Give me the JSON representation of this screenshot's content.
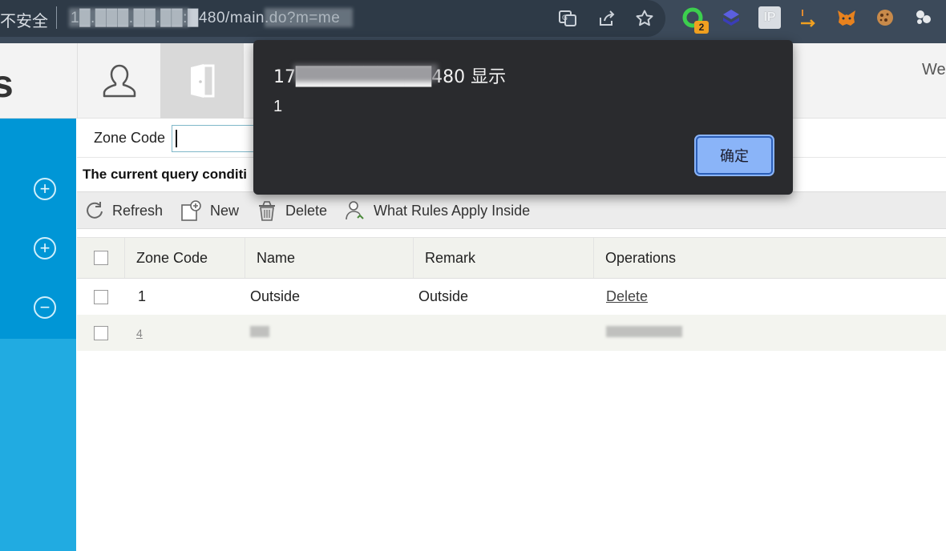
{
  "browser": {
    "security_label": "不安全",
    "url": "1█.███.██.██:█480/main.do?m=me",
    "extension_badge": "2",
    "ip_ext_label": "IP"
  },
  "header": {
    "brand_fragment": "s",
    "welcome": "We"
  },
  "query": {
    "zone_code_label": "Zone Code",
    "zone_code_value": "",
    "condition_text": "The current query conditi"
  },
  "toolbar": {
    "refresh": "Refresh",
    "new": "New",
    "delete": "Delete",
    "rules": "What Rules Apply Inside"
  },
  "table": {
    "headers": [
      "Zone Code",
      "Name",
      "Remark",
      "Operations"
    ],
    "rows": [
      {
        "zone_code": "1",
        "name": "Outside",
        "remark": "Outside",
        "operation": "Delete"
      },
      {
        "zone_code": "4",
        "name": "",
        "remark": "",
        "operation": ""
      }
    ]
  },
  "alert": {
    "title": "17██████████480 显示",
    "message": "1",
    "ok_label": "确定"
  },
  "colors": {
    "sidebar_dark": "#0096d6",
    "sidebar_light": "#21abe1",
    "dialog_bg": "#2a2b2e",
    "dialog_button": "#8ab4f8"
  },
  "icons": [
    "translate-icon",
    "share-icon",
    "star-icon",
    "extension-green-icon",
    "extension-stack-icon",
    "ip-icon",
    "extension-arrow-icon",
    "metamask-icon",
    "cookie-icon",
    "extension-dots-icon",
    "user-icon",
    "door-icon",
    "plus-circle-icon",
    "minus-circle-icon",
    "refresh-icon",
    "new-icon",
    "trash-icon",
    "user-rules-icon"
  ]
}
